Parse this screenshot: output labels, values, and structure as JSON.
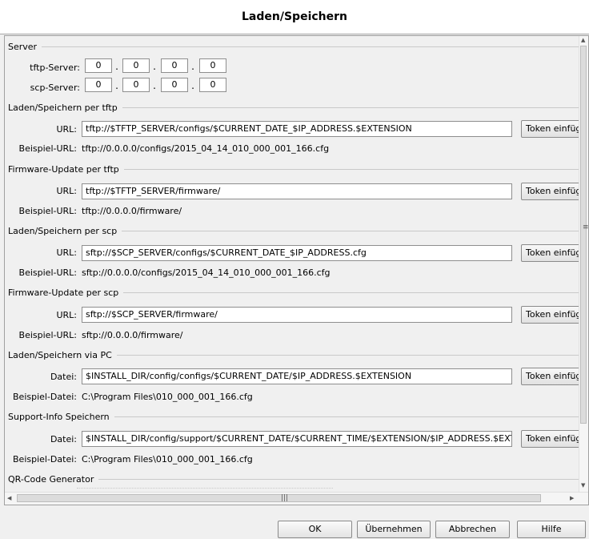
{
  "window": {
    "title": "Laden/Speichern"
  },
  "server": {
    "header": "Server",
    "tftp": {
      "label": "tftp-Server:",
      "octets": [
        "0",
        "0",
        "0",
        "0"
      ]
    },
    "scp": {
      "label": "scp-Server:",
      "octets": [
        "0",
        "0",
        "0",
        "0"
      ]
    }
  },
  "sections": [
    {
      "header": "Laden/Speichern per tftp",
      "label": "URL:",
      "value": "tftp://$TFTP_SERVER/configs/$CURRENT_DATE_$IP_ADDRESS.$EXTENSION",
      "example_label": "Beispiel-URL:",
      "example": "tftp://0.0.0.0/configs/2015_04_14_010_000_001_166.cfg"
    },
    {
      "header": "Firmware-Update per tftp",
      "label": "URL:",
      "value": "tftp://$TFTP_SERVER/firmware/",
      "example_label": "Beispiel-URL:",
      "example": "tftp://0.0.0.0/firmware/"
    },
    {
      "header": "Laden/Speichern per scp",
      "label": "URL:",
      "value": "sftp://$SCP_SERVER/configs/$CURRENT_DATE_$IP_ADDRESS.cfg",
      "example_label": "Beispiel-URL:",
      "example": "sftp://0.0.0.0/configs/2015_04_14_010_000_001_166.cfg"
    },
    {
      "header": "Firmware-Update per scp",
      "label": "URL:",
      "value": "sftp://$SCP_SERVER/firmware/",
      "example_label": "Beispiel-URL:",
      "example": "sftp://0.0.0.0/firmware/"
    },
    {
      "header": "Laden/Speichern via PC",
      "label": "Datei:",
      "value": "$INSTALL_DIR/config/configs/$CURRENT_DATE/$IP_ADDRESS.$EXTENSION",
      "example_label": "Beispiel-Datei:",
      "example": "C:\\Program Files\\010_000_001_166.cfg"
    },
    {
      "header": "Support-Info Speichern",
      "label": "Datei:",
      "value": "$INSTALL_DIR/config/support/$CURRENT_DATE/$CURRENT_TIME/$EXTENSION/$IP_ADDRESS.$EXTENSION",
      "example_label": "Beispiel-Datei:",
      "example": "C:\\Program Files\\010_000_001_166.cfg"
    }
  ],
  "token_button": "Token einfügen",
  "qr_header": "QR-Code Generator",
  "buttons": {
    "ok": "OK",
    "apply": "Übernehmen",
    "cancel": "Abbrechen",
    "help": "Hilfe"
  }
}
